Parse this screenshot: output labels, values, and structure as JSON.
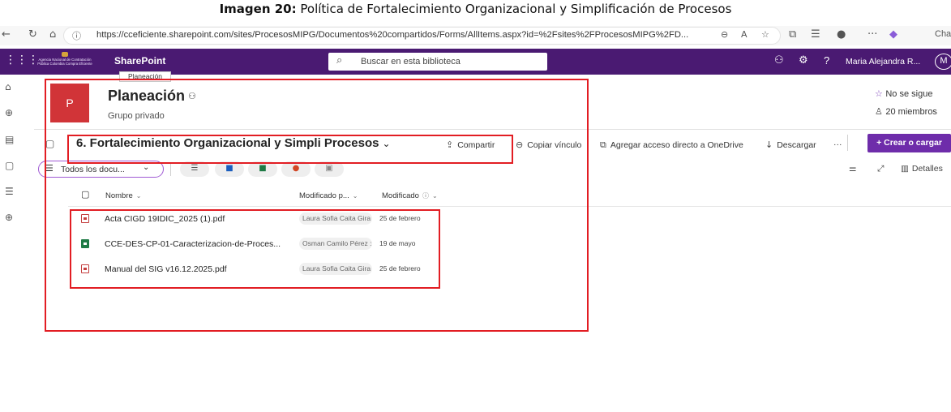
{
  "caption": {
    "prefix": "Imagen 20:",
    "text": " Política de Fortalecimiento Organizacional y Simplificación de Procesos"
  },
  "browser": {
    "url": "https://cceficiente.sharepoint.com/sites/ProcesosMIPG/Documentos%20compartidos/Forms/AllItems.aspx?id=%2Fsites%2FProcesosMIPG%2FD...",
    "chat_label": "Chat"
  },
  "suite": {
    "brand": "SharePoint",
    "org_logo_text": "Agencia Nacional de Contratación Pública Colombia Compra Eficiente",
    "search_placeholder": "Buscar en esta biblioteca",
    "user_name": "Maria Alejandra R...",
    "avatar_initial": "M"
  },
  "tooltip": "Planeación",
  "site": {
    "logo_letter": "P",
    "title": "Planeación",
    "subtitle": "Grupo privado",
    "follow_label": "No se sigue",
    "members_label": "20 miembros"
  },
  "library": {
    "title": "6. Fortalecimiento Organizacional y Simpli Procesos",
    "commands": {
      "share": "Compartir",
      "copy_link": "Copiar vínculo",
      "shortcut": "Agregar acceso directo a OneDrive",
      "download": "Descargar",
      "more": "···",
      "new": "+ Crear o cargar"
    },
    "view": "Todos los docu...",
    "details": "Detalles"
  },
  "table": {
    "headers": {
      "name": "Nombre",
      "modified_by": "Modificado p...",
      "modified": "Modificado"
    },
    "rows": [
      {
        "name": "Acta CIGD 19IDIC_2025 (1).pdf",
        "type": "pdf",
        "user": "Laura Sofia Caita Gira",
        "date": "25 de febrero"
      },
      {
        "name": "CCE-DES-CP-01-Caracterizacion-de-Proces...",
        "type": "xlsx",
        "user": "Osman Camilo Pérez :",
        "date": "19 de mayo"
      },
      {
        "name": "Manual del SIG v16.12.2025.pdf",
        "type": "pdf",
        "user": "Laura Sofia Caita Gira",
        "date": "25 de febrero"
      }
    ]
  },
  "colors": {
    "suite_bar": "#4a1a72",
    "site_logo": "#d13438",
    "primary_button": "#6e2caa",
    "annotation": "#e21d23"
  }
}
